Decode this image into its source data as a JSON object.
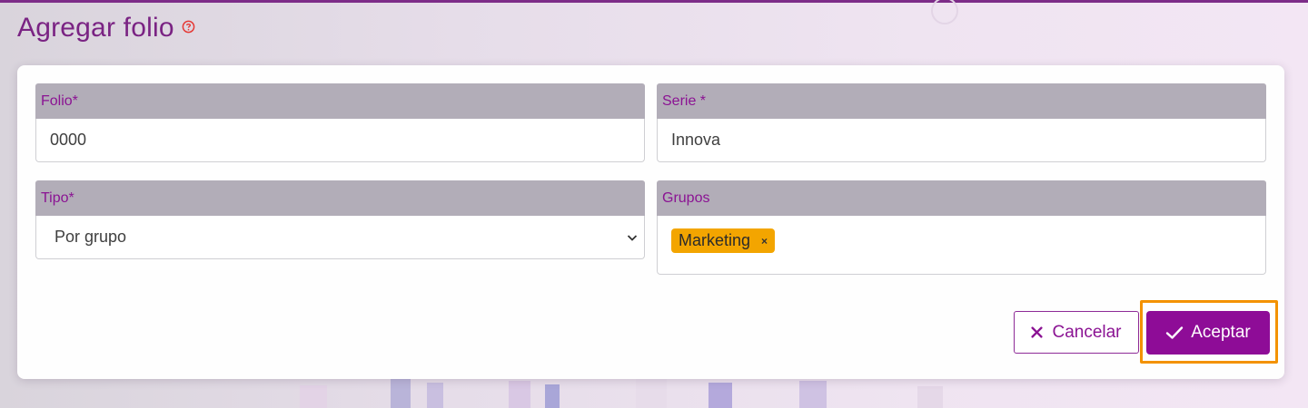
{
  "page": {
    "title": "Agregar folio"
  },
  "form": {
    "folio": {
      "label": "Folio*",
      "value": "0000"
    },
    "serie": {
      "label": "Serie *",
      "value": "Innova"
    },
    "tipo": {
      "label": "Tipo*",
      "selected": "Por grupo"
    },
    "grupos": {
      "label": "Grupos",
      "tags": [
        "Marketing"
      ],
      "tag_remove": "×"
    }
  },
  "actions": {
    "cancel_label": "Cancelar",
    "accept_label": "Aceptar"
  },
  "colors": {
    "accent": "#8e0c97",
    "tag": "#f3a500",
    "focus": "#f39200",
    "header_bg": "#b2adb8"
  },
  "icons": {
    "help": "help-circle-icon",
    "select": "chevron-down-icon",
    "cancel": "close-icon",
    "accept": "check-icon"
  }
}
